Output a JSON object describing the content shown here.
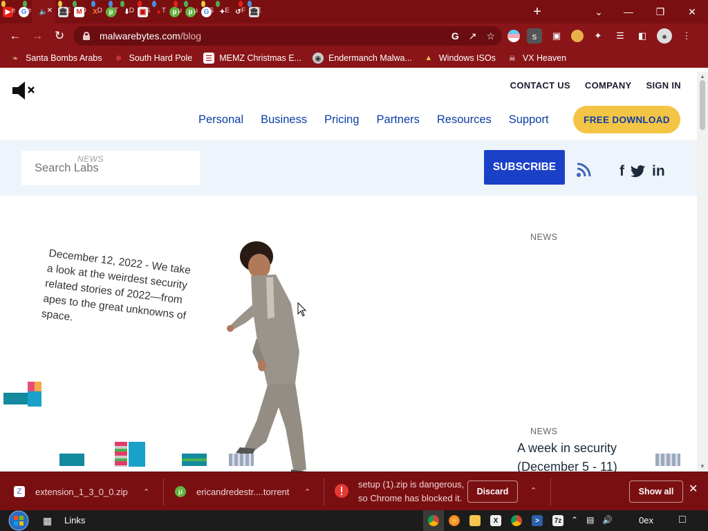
{
  "browser": {
    "tab_letters": [
      "e",
      "e",
      "",
      "E",
      "D",
      "D",
      "T",
      "D",
      "S",
      "T",
      "μ",
      "μ",
      "S",
      "E",
      "F",
      "E"
    ],
    "url_domain": "malwarebytes.com",
    "url_path": "/blog",
    "window_controls": {
      "minimize": "—",
      "restore": "❐",
      "close": "✕"
    }
  },
  "bookmarks": [
    {
      "label": "Santa Bombs Arabs",
      "icon": "reindeer-icon"
    },
    {
      "label": "South Hard Pole",
      "icon": "snowflake-icon"
    },
    {
      "label": "MEMZ Christmas E...",
      "icon": "page-icon"
    },
    {
      "label": "Endermanch Malwa...",
      "icon": "raccoon-icon"
    },
    {
      "label": "Windows ISOs",
      "icon": "figure-icon"
    },
    {
      "label": "VX Heaven",
      "icon": "skull-icon"
    }
  ],
  "site": {
    "top_links": [
      "CONTACT US",
      "COMPANY",
      "SIGN IN"
    ],
    "nav": [
      "Personal",
      "Business",
      "Pricing",
      "Partners",
      "Resources",
      "Support"
    ],
    "cta": "FREE DOWNLOAD",
    "search_placeholder": "Search Labs",
    "floating_news": "NEWS",
    "subscribe": "SUBSCRIBE",
    "news_label_1": "NEWS",
    "news_label_2": "NEWS",
    "article_title": "A week in security (December 5 - 11)",
    "excerpt": "December 12, 2022 - We take a look at the weirdest security related stories of 2022—from apes to the great unknowns of space."
  },
  "downloads": [
    {
      "name": "extension_1_3_0_0.zip"
    },
    {
      "name": "ericandredestr....torrent"
    }
  ],
  "blocked_download": {
    "message": "setup (1).zip is dangerous, so Chrome has blocked it.",
    "discard": "Discard"
  },
  "show_all": "Show all",
  "taskbar": {
    "links_label": "Links",
    "clock": "0ex"
  },
  "colors": {
    "chrome_frame": "#7a0f12",
    "toolbar": "#8a1518",
    "brand_blue": "#0d3ea3",
    "subscribe_blue": "#1a40c8",
    "cta_yellow": "#f4c445"
  }
}
